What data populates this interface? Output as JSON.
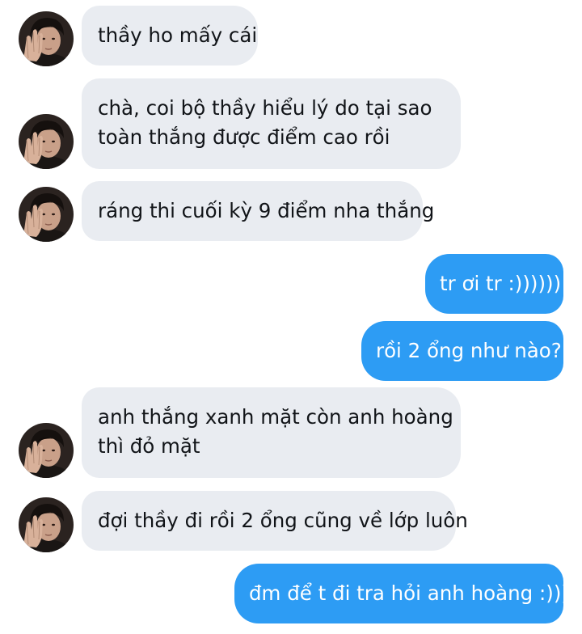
{
  "conversation": {
    "contact_avatar": "user-avatar-photo",
    "incoming_bubble_color": "#e9ecf1",
    "outgoing_bubble_color": "#2d9cf4",
    "messages": [
      {
        "direction": "incoming",
        "text": "thầy ho mấy cái"
      },
      {
        "direction": "incoming",
        "lines": [
          "chà, coi bộ thầy hiểu lý do tại sao",
          "toàn thắng được điểm cao rồi"
        ]
      },
      {
        "direction": "incoming",
        "text": "ráng thi cuối kỳ 9 điểm nha thắng"
      },
      {
        "direction": "outgoing",
        "text": "tr ơi tr :))))))"
      },
      {
        "direction": "outgoing",
        "text": "rồi 2 ổng như nào?"
      },
      {
        "direction": "incoming",
        "lines": [
          "anh thắng xanh mặt còn anh hoàng",
          "thì đỏ mặt"
        ]
      },
      {
        "direction": "incoming",
        "text": "đợi thầy đi rồi 2 ổng cũng về lớp luôn"
      },
      {
        "direction": "outgoing",
        "text": "đm để t đi tra hỏi anh hoàng :))))"
      }
    ]
  }
}
